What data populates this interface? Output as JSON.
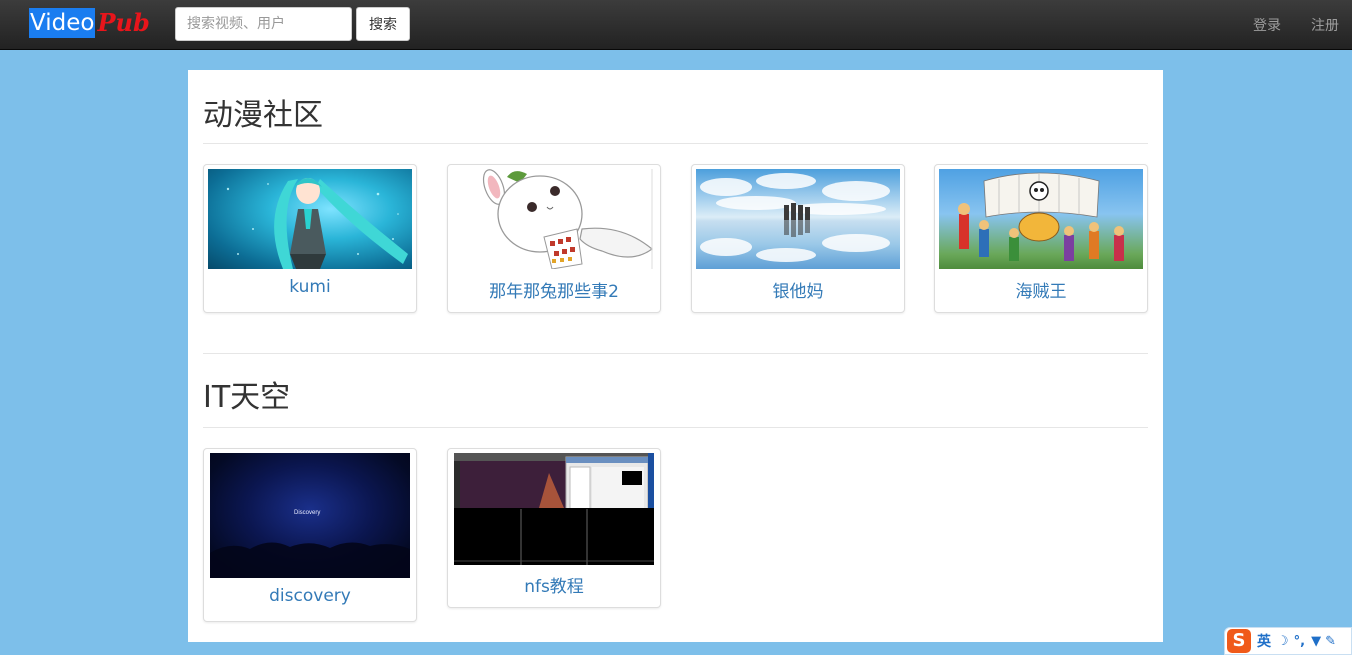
{
  "navbar": {
    "brand_video": "Video",
    "brand_pub": "Pub",
    "search_placeholder": "搜索视频、用户",
    "search_button": "搜索",
    "login": "登录",
    "register": "注册"
  },
  "sections": [
    {
      "title": "动漫社区",
      "cards": [
        {
          "label": "kumi"
        },
        {
          "label": "那年那兔那些事2"
        },
        {
          "label": "银他妈"
        },
        {
          "label": "海贼王"
        }
      ]
    },
    {
      "title": "IT天空",
      "cards": [
        {
          "label": "discovery",
          "thumb_text": "Discovery"
        },
        {
          "label": "nfs教程"
        }
      ]
    }
  ],
  "ime": {
    "logo": "S",
    "mode": "英"
  },
  "colors": {
    "page_bg": "#7dbfea",
    "navbar_bg": "#222222",
    "link": "#337ab7",
    "brand_video_bg": "#1a7df0",
    "brand_pub": "#e8151b"
  }
}
